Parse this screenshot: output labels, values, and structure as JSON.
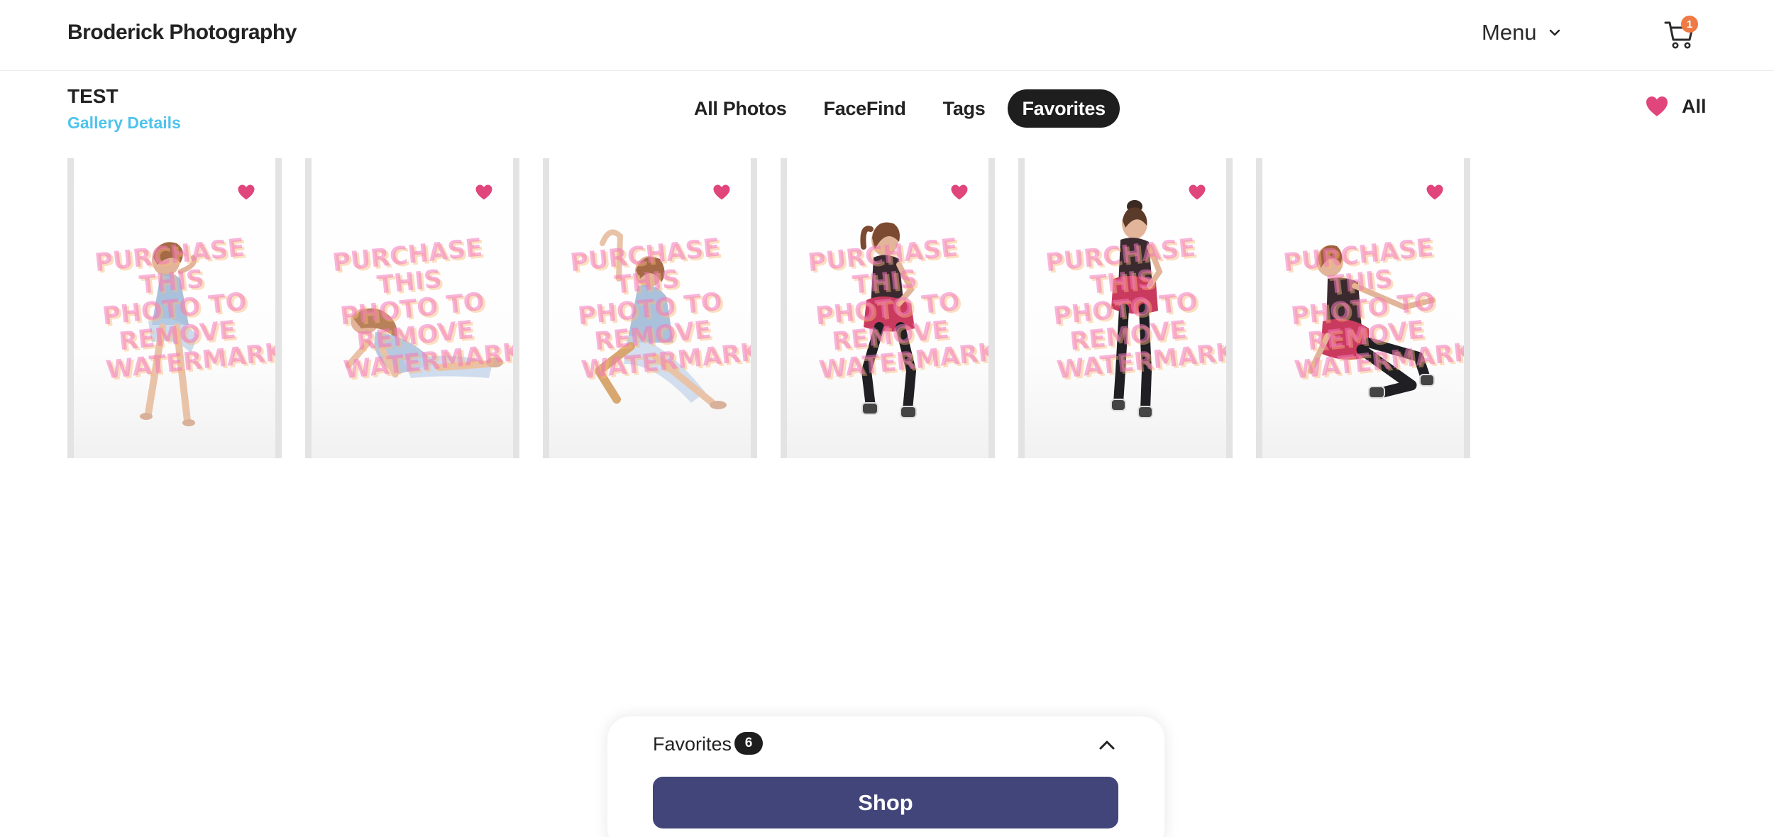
{
  "header": {
    "brand": "Broderick Photography",
    "menu_label": "Menu",
    "cart_count": "1",
    "cart_badge_color": "#ef7a45"
  },
  "gallery": {
    "title": "TEST",
    "details_link": "Gallery Details",
    "details_color": "#4fc3ec"
  },
  "tabs": [
    {
      "label": "All Photos",
      "active": false
    },
    {
      "label": "FaceFind",
      "active": false
    },
    {
      "label": "Tags",
      "active": false
    },
    {
      "label": "Favorites",
      "active": true
    }
  ],
  "favorites_filter": {
    "label": "All",
    "icon": "heart-icon",
    "color": "#e0457b"
  },
  "photos": [
    {
      "watermark": "PURCHASE THIS PHOTO TO REMOVE WATERMARK",
      "favorited": true,
      "pose": "standing-blue-dress"
    },
    {
      "watermark": "PURCHASE THIS PHOTO TO REMOVE WATERMARK",
      "favorited": true,
      "pose": "floor-blue-dress"
    },
    {
      "watermark": "PURCHASE THIS PHOTO TO REMOVE WATERMARK",
      "favorited": true,
      "pose": "kneeling-arm-raised-blue-dress"
    },
    {
      "watermark": "PURCHASE THIS PHOTO TO REMOVE WATERMARK",
      "favorited": true,
      "pose": "standing-red-sequin"
    },
    {
      "watermark": "PURCHASE THIS PHOTO TO REMOVE WATERMARK",
      "favorited": true,
      "pose": "standing-red-sequin-hip"
    },
    {
      "watermark": "PURCHASE THIS PHOTO TO REMOVE WATERMARK",
      "favorited": true,
      "pose": "kneeling-red-sequin"
    }
  ],
  "bottom_panel": {
    "title": "Favorites",
    "count": "6",
    "shop_label": "Shop",
    "shop_color": "#41457a"
  }
}
